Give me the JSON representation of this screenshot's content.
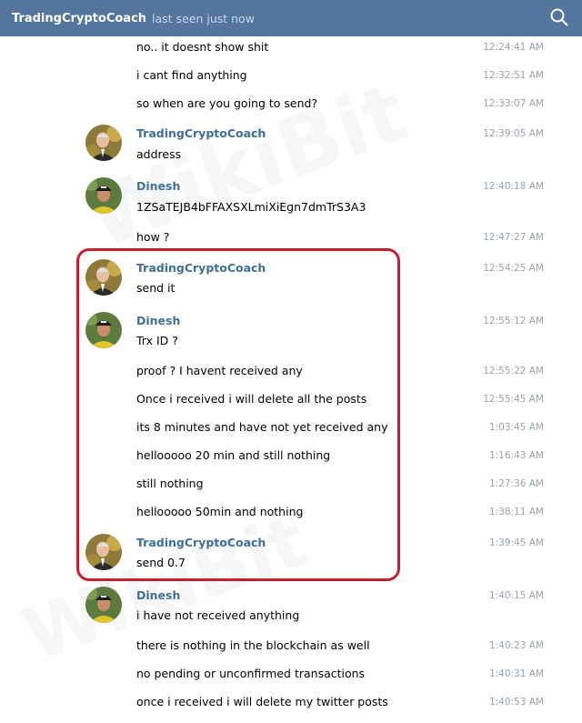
{
  "header": {
    "title": "TradingCryptoCoach",
    "status": "last seen just now",
    "search_icon": "search-icon"
  },
  "watermark": "WikiBit",
  "senders": {
    "coach": "TradingCryptoCoach",
    "dinesh": "Dinesh"
  },
  "messages": [
    {
      "text": "no.. it doesnt show shit",
      "time": "12:24:41 AM"
    },
    {
      "text": "i cant find anything",
      "time": "12:32:51 AM"
    },
    {
      "text": "so when are you going to send?",
      "time": "12:33:07 AM"
    },
    {
      "sender": "TradingCryptoCoach",
      "text": "address",
      "time": "12:39:05 AM"
    },
    {
      "sender": "Dinesh",
      "text": "1ZSaTEJB4bFFAXSXLmiXiEgn7dmTrS3A3",
      "time": "12:40:18 AM"
    },
    {
      "text": "how ?",
      "time": "12:47:27 AM"
    },
    {
      "sender": "TradingCryptoCoach",
      "text": "send it",
      "time": "12:54:25 AM"
    },
    {
      "sender": "Dinesh",
      "text": "Trx ID ?",
      "time": "12:55:12 AM"
    },
    {
      "text": "proof ? I havent received any",
      "time": "12:55:22 AM"
    },
    {
      "text": "Once i received i will delete all the posts",
      "time": "12:55:45 AM"
    },
    {
      "text": "its 8 minutes and have not yet received any",
      "time": "1:03:45 AM"
    },
    {
      "text": "hellooooo 20 min and still nothing",
      "time": "1:16:43 AM"
    },
    {
      "text": "still nothing",
      "time": "1:27:36 AM"
    },
    {
      "text": "hellooooo 50min and nothing",
      "time": "1:38:11 AM"
    },
    {
      "sender": "TradingCryptoCoach",
      "text": "send 0.7",
      "time": "1:39:45 AM"
    },
    {
      "sender": "Dinesh",
      "text": "i have not received anything",
      "time": "1:40:15 AM"
    },
    {
      "text": "there is nothing in the blockchain as well",
      "time": "1:40:23 AM"
    },
    {
      "text": "no pending or unconfirmed transactions",
      "time": "1:40:31 AM"
    },
    {
      "text": "once i received i will delete my twitter posts",
      "time": "1:40:53 AM"
    }
  ]
}
